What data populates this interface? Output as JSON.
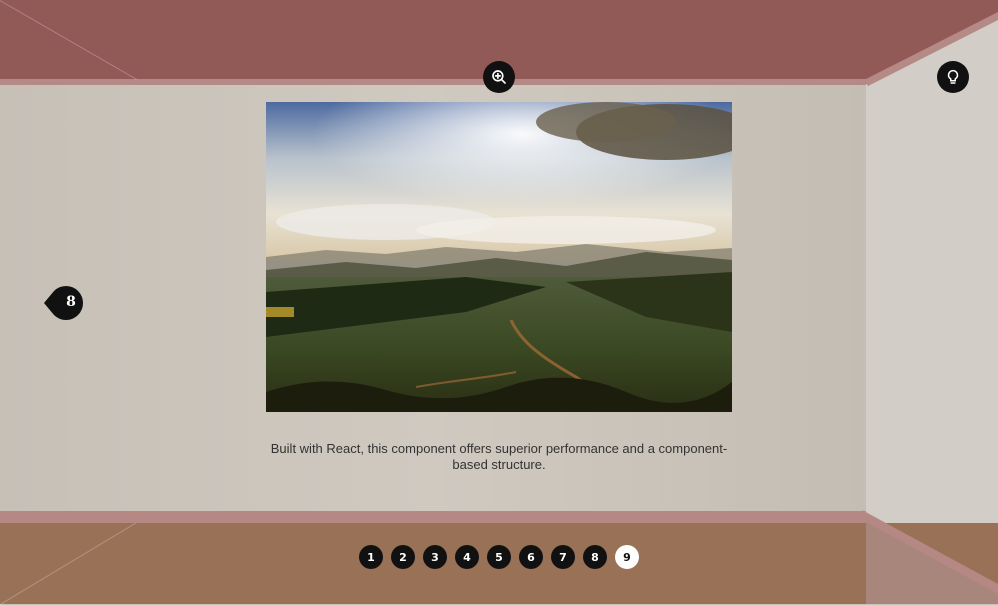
{
  "gallery": {
    "caption": "Built with React, this component offers superior performance and a component-based structure.",
    "prev_label": "8",
    "pages": [
      "1",
      "2",
      "3",
      "4",
      "5",
      "6",
      "7",
      "8",
      "9"
    ],
    "active_page": "9"
  },
  "icons": {
    "zoom": "zoom-in-icon",
    "hint": "lightbulb-icon",
    "prev": "chevron-left-icon"
  },
  "colors": {
    "ceiling": "#925a56",
    "wall": "#c9c2b9",
    "floor": "#987156",
    "button": "#111111",
    "active_dot": "#ffffff"
  }
}
